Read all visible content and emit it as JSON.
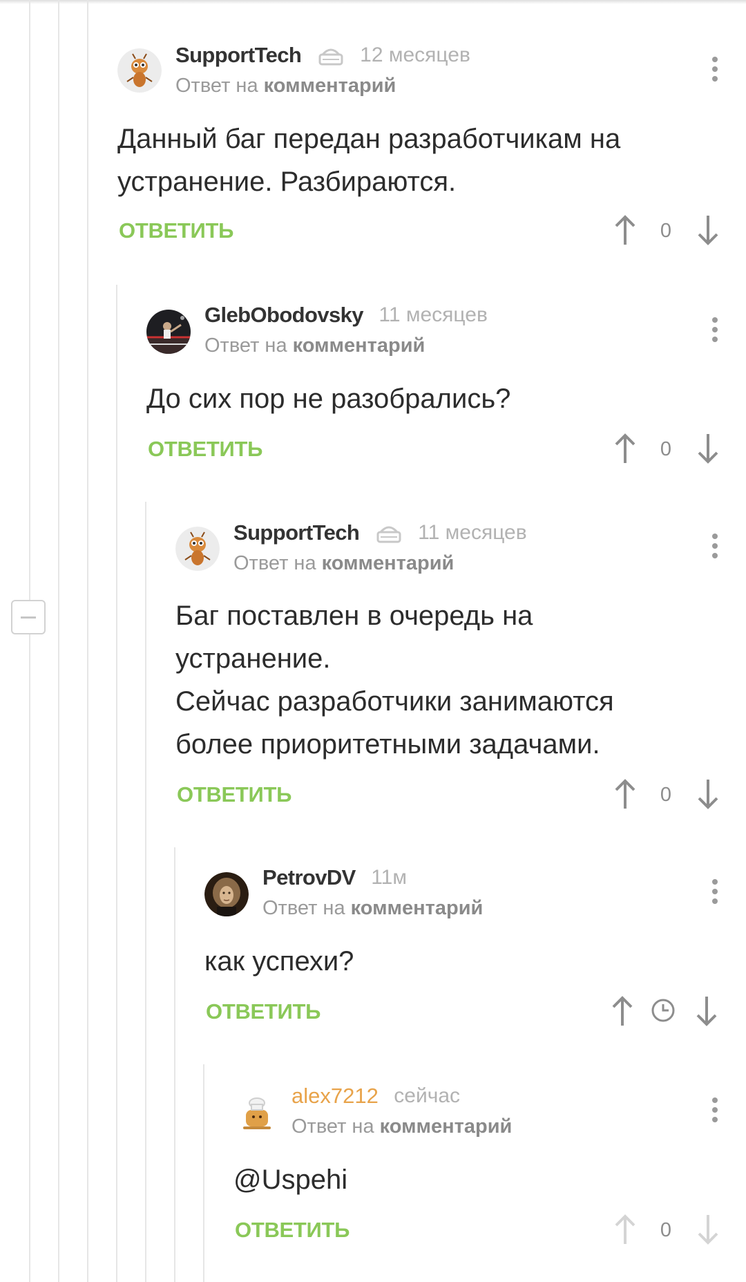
{
  "reply_prefix": "Ответ на",
  "reply_link": "комментарий",
  "answer_label": "ОТВЕТИТЬ",
  "icons": {
    "upvote": "arrow-up-icon",
    "downvote": "arrow-down-icon",
    "more": "more-vertical-icon",
    "cake": "cake-icon",
    "pending": "clock-icon",
    "collapse": "minus-icon"
  },
  "colors": {
    "answer": "#8ac858",
    "author_highlight": "#e8a34a",
    "thread_line": "#e6e6e6"
  },
  "comments": [
    {
      "author": "SupportTech",
      "time": "12 месяцев",
      "body": [
        "Данный баг передан разработчикам на",
        "устранение. Разбираются."
      ],
      "score": "0"
    },
    {
      "author": "GlebObodovsky",
      "time": "11 месяцев",
      "body": [
        "До сих пор не разобрались?"
      ],
      "score": "0"
    },
    {
      "author": "SupportTech",
      "time": "11 месяцев",
      "body": [
        "Баг поставлен в очередь на",
        "устранение.",
        "Сейчас разработчики занимаются",
        "более приоритетными задачами."
      ],
      "score": "0"
    },
    {
      "author": "PetrovDV",
      "time": "11м",
      "body": [
        "как успехи?"
      ],
      "score": ""
    },
    {
      "author": "alex7212",
      "time": "сейчас",
      "body": [
        "@Uspehi"
      ],
      "score": "0"
    }
  ]
}
